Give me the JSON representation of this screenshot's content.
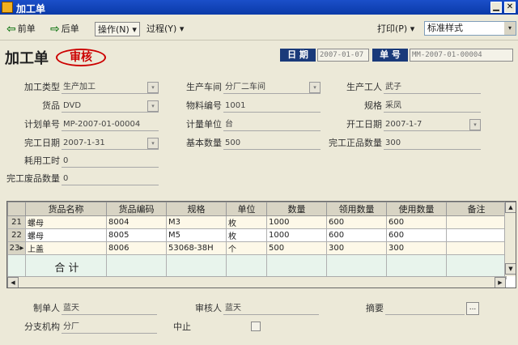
{
  "window": {
    "title": "加工单",
    "min_glyph": "▁",
    "close_glyph": "✕"
  },
  "toolbar": {
    "prev_label": "前单",
    "next_label": "后单",
    "operate_label": "操作(N)",
    "process_label": "过程(Y)",
    "print_label": "打印(P)",
    "style_value": "标准样式",
    "arrow_left": "⇦",
    "arrow_right": "⇨",
    "caret": "▾"
  },
  "header": {
    "doc_title": "加工单",
    "stamp": "审核",
    "date_label": "日 期",
    "date_value": "2007-01-07",
    "number_label": "单 号",
    "number_value": "MM-2007-01-00004"
  },
  "form": {
    "fields": {
      "proc_type": {
        "label": "加工类型",
        "value": "生产加工"
      },
      "workshop": {
        "label": "生产车间",
        "value": "分厂二车间"
      },
      "worker": {
        "label": "生产工人",
        "value": "武子"
      },
      "goods": {
        "label": "货品",
        "value": "DVD"
      },
      "material_no": {
        "label": "物料编号",
        "value": "1001"
      },
      "spec": {
        "label": "规格",
        "value": "采凤"
      },
      "plan_no": {
        "label": "计划单号",
        "value": "MP-2007-01-00004"
      },
      "unit": {
        "label": "计量单位",
        "value": "台"
      },
      "start_date": {
        "label": "开工日期",
        "value": "2007-1-7"
      },
      "finish_date": {
        "label": "完工日期",
        "value": "2007-1-31"
      },
      "base_qty": {
        "label": "基本数量",
        "value": "500"
      },
      "good_qty": {
        "label": "完工正品数量",
        "value": "300"
      },
      "hours": {
        "label": "耗用工时",
        "value": "0"
      },
      "waste_qty": {
        "label": "完工废品数量",
        "value": "0"
      }
    }
  },
  "grid": {
    "columns": [
      "货品名称",
      "货品编码",
      "规格",
      "单位",
      "数量",
      "领用数量",
      "使用数量",
      "备注"
    ],
    "rows": [
      {
        "num": "21",
        "cells": [
          "螺母",
          "8004",
          "M3",
          "枚",
          "1000",
          "600",
          "600",
          ""
        ]
      },
      {
        "num": "22",
        "cells": [
          "螺母",
          "8005",
          "M5",
          "枚",
          "1000",
          "600",
          "600",
          ""
        ]
      },
      {
        "num": "23▸",
        "cells": [
          "上盖",
          "8006",
          "53068-38H",
          "个",
          "500",
          "300",
          "300",
          ""
        ]
      }
    ],
    "total_label": "合 计",
    "arrows": {
      "up": "▲",
      "down": "▼",
      "left": "◀",
      "right": "▶"
    }
  },
  "footer": {
    "maker_label": "制单人",
    "maker_value": "蓝天",
    "reviewer_label": "审核人",
    "reviewer_value": "蓝天",
    "summary_label": "摘要",
    "summary_value": "",
    "branch_label": "分支机构",
    "branch_value": "分厂",
    "stop_label": "中止",
    "ellipsis": "..."
  }
}
